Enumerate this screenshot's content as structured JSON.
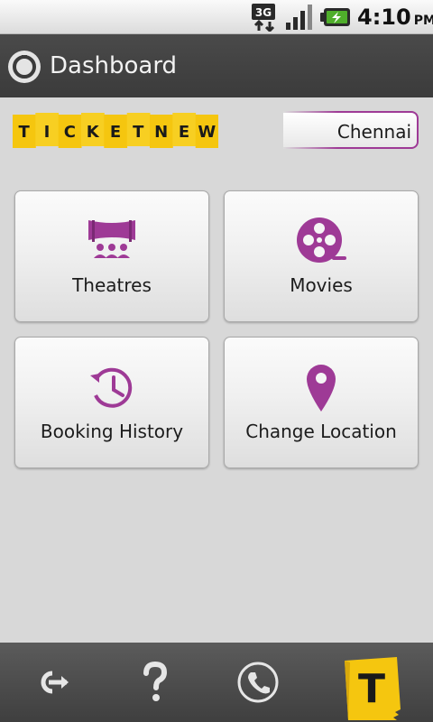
{
  "status_bar": {
    "network": "3G",
    "time": "4:10",
    "ampm": "PM"
  },
  "header": {
    "title": "Dashboard"
  },
  "brand": {
    "logo_letters": [
      "T",
      "I",
      "C",
      "K",
      "E",
      "T",
      "N",
      "E",
      "W"
    ],
    "bottom_logo_letter": "T",
    "colors": {
      "accent": "#9e3a96",
      "logo_yellow": "#f5c60f"
    }
  },
  "location": {
    "city": "Chennai"
  },
  "tiles": [
    {
      "label": "Theatres",
      "icon": "theatre-icon"
    },
    {
      "label": "Movies",
      "icon": "film-reel-icon"
    },
    {
      "label": "Booking History",
      "icon": "history-icon"
    },
    {
      "label": "Change Location",
      "icon": "map-pin-icon"
    }
  ],
  "bottom_bar": {
    "items": [
      {
        "icon": "exit-icon"
      },
      {
        "icon": "help-icon"
      },
      {
        "icon": "phone-icon"
      },
      {
        "icon": "ticketnew-icon"
      }
    ]
  }
}
